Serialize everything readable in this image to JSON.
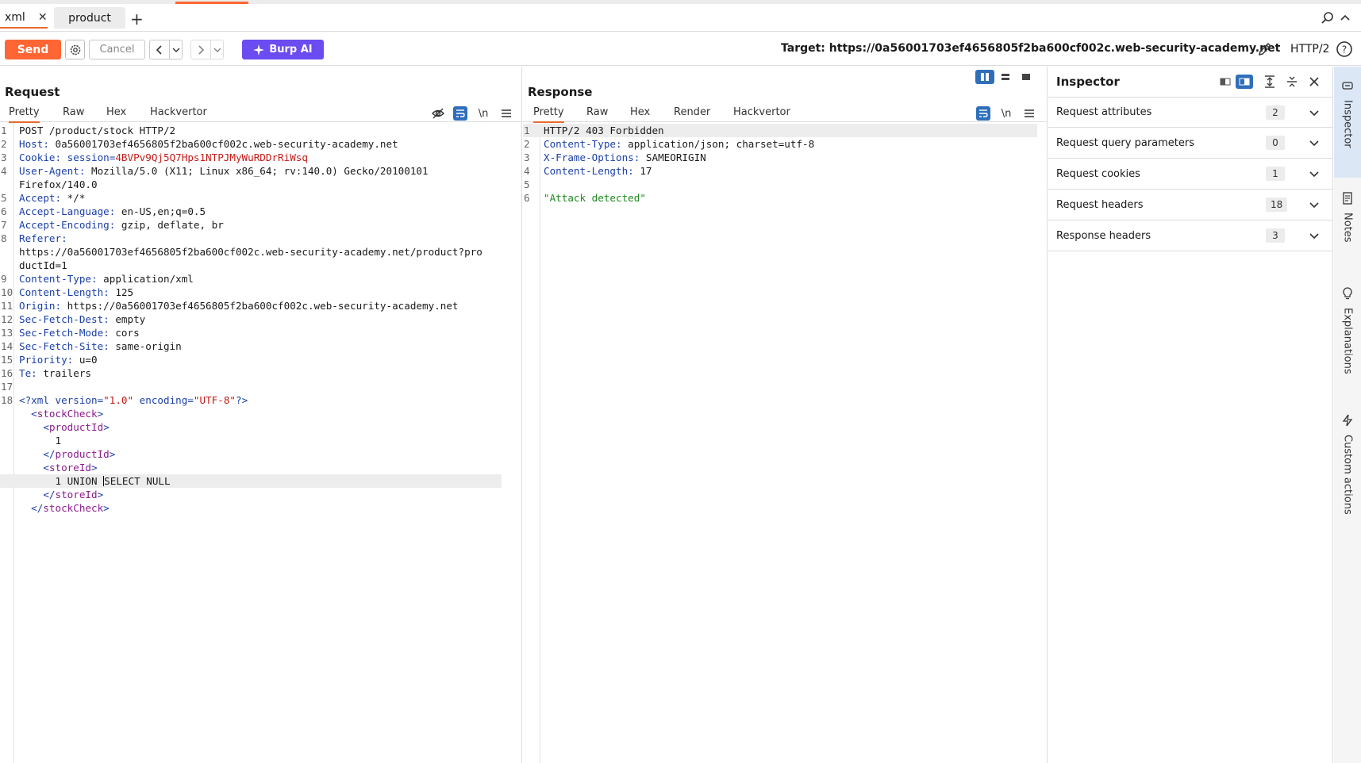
{
  "tabs": [
    {
      "label": "xml",
      "active": true
    },
    {
      "label": "product",
      "active": false
    }
  ],
  "toolbar": {
    "send_label": "Send",
    "cancel_label": "Cancel",
    "burp_ai_label": "Burp AI",
    "target_label": "Target: https://0a56001703ef4656805f2ba600cf002c.web-security-academy.net",
    "protocol_label": "HTTP/2"
  },
  "request": {
    "title": "Request",
    "subtabs": [
      "Pretty",
      "Raw",
      "Hex",
      "Hackvertor"
    ],
    "lines": {
      "l1": "POST /product/stock HTTP/2",
      "l2k": "Host:",
      "l2v": " 0a56001703ef4656805f2ba600cf002c.web-security-academy.net",
      "l3k": "Cookie:",
      "l3a": " session=",
      "l3v": "4BVPv9Qj5Q7Hps1NTPJMyWuRDDrRiWsq",
      "l4k": "User-Agent:",
      "l4v": " Mozilla/5.0 (X11; Linux x86_64; rv:140.0) Gecko/20100101",
      "l4c": "Firefox/140.0",
      "l5k": "Accept:",
      "l5v": " */*",
      "l6k": "Accept-Language:",
      "l6v": " en-US,en;q=0.5",
      "l7k": "Accept-Encoding:",
      "l7v": " gzip, deflate, br",
      "l8k": "Referer:",
      "l8c1": "https://0a56001703ef4656805f2ba600cf002c.web-security-academy.net/product?pro",
      "l8c2": "ductId=1",
      "l9k": "Content-Type:",
      "l9v": " application/xml",
      "l10k": "Content-Length:",
      "l10v": " 125",
      "l11k": "Origin:",
      "l11v": " https://0a56001703ef4656805f2ba600cf002c.web-security-academy.net",
      "l12k": "Sec-Fetch-Dest:",
      "l12v": " empty",
      "l13k": "Sec-Fetch-Mode:",
      "l13v": " cors",
      "l14k": "Sec-Fetch-Site:",
      "l14v": " same-origin",
      "l15k": "Priority:",
      "l15v": " u=0",
      "l16k": "Te:",
      "l16v": " trailers",
      "x_open": "<?xml",
      "x_ver_attr": " version=",
      "x_ver_val": "\"1.0\"",
      "x_enc_attr": " encoding=",
      "x_enc_val": "\"UTF-8\"",
      "x_close": "?>",
      "stock_open": "stockCheck",
      "pid": "productId",
      "pid_val": "1",
      "sid": "storeId",
      "sid_val_a": "1 UNION ",
      "sid_val_b": "SELECT NULL"
    }
  },
  "response": {
    "title": "Response",
    "subtabs": [
      "Pretty",
      "Raw",
      "Hex",
      "Render",
      "Hackvertor"
    ],
    "lines": {
      "r1": "HTTP/2 403 Forbidden",
      "r2k": "Content-Type:",
      "r2v": " application/json; charset=utf-8",
      "r3k": "X-Frame-Options:",
      "r3v": " SAMEORIGIN",
      "r4k": "Content-Length:",
      "r4v": " 17",
      "r6": "\"Attack detected\""
    }
  },
  "inspector": {
    "title": "Inspector",
    "rows": [
      {
        "label": "Request attributes",
        "count": "2"
      },
      {
        "label": "Request query parameters",
        "count": "0"
      },
      {
        "label": "Request cookies",
        "count": "1"
      },
      {
        "label": "Request headers",
        "count": "18"
      },
      {
        "label": "Response headers",
        "count": "3"
      }
    ]
  },
  "rail": [
    "Inspector",
    "Notes",
    "Explanations",
    "Custom actions"
  ],
  "line_numbers": {
    "n1": "1",
    "n2": "2",
    "n3": "3",
    "n4": "4",
    "n5": "5",
    "n6": "6",
    "n7": "7",
    "n8": "8",
    "n9": "9",
    "n10": "10",
    "n11": "11",
    "n12": "12",
    "n13": "13",
    "n14": "14",
    "n15": "15",
    "n16": "16",
    "n17": "17",
    "n18": "18"
  }
}
